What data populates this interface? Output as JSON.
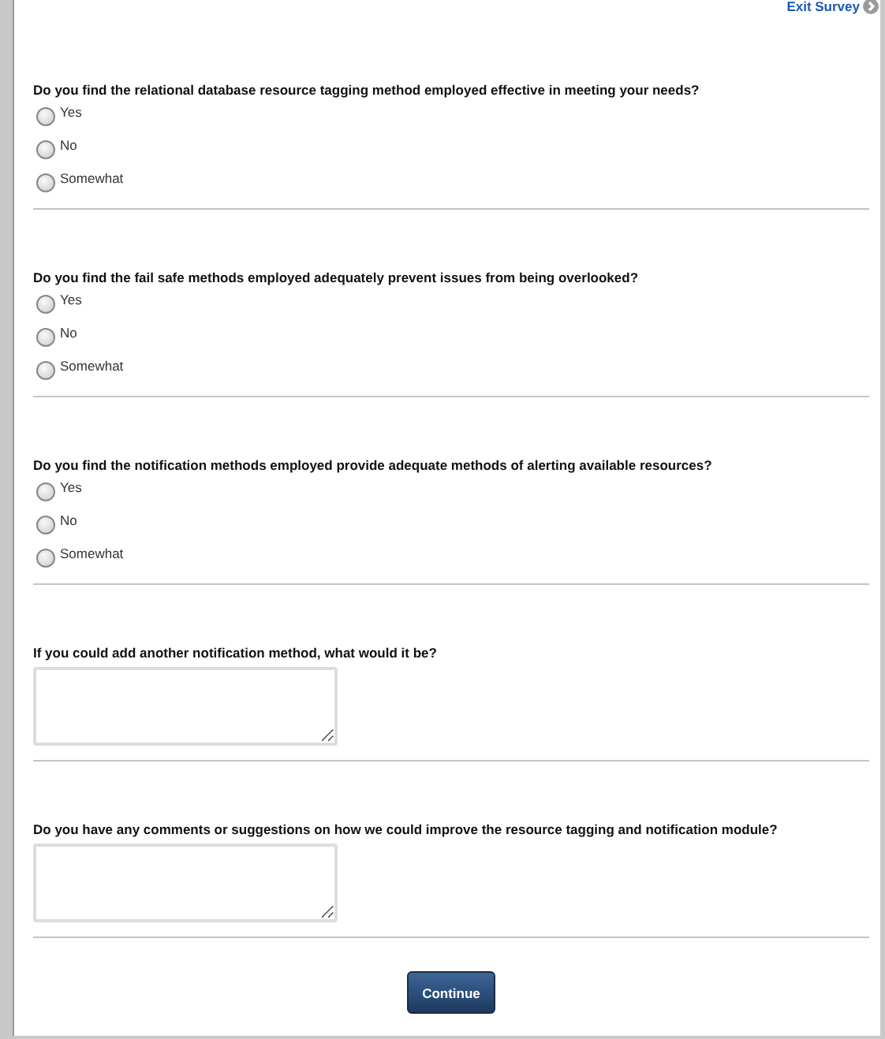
{
  "exit_link": {
    "label": "Exit Survey"
  },
  "questions": [
    {
      "kind": "radio",
      "text": "Do you find the relational database resource tagging method employed effective in meeting your needs?",
      "options": [
        {
          "label": "Yes",
          "selected": false
        },
        {
          "label": "No",
          "selected": false
        },
        {
          "label": "Somewhat",
          "selected": false
        }
      ]
    },
    {
      "kind": "radio",
      "text": "Do you find the fail safe methods employed adequately prevent issues from being overlooked?",
      "options": [
        {
          "label": "Yes",
          "selected": false
        },
        {
          "label": "No",
          "selected": false
        },
        {
          "label": "Somewhat",
          "selected": false
        }
      ]
    },
    {
      "kind": "radio",
      "text": "Do you find the notification methods employed provide adequate methods of alerting available resources?",
      "options": [
        {
          "label": "Yes",
          "selected": false
        },
        {
          "label": "No",
          "selected": false
        },
        {
          "label": "Somewhat",
          "selected": false
        }
      ]
    },
    {
      "kind": "text",
      "text": "If you could add another notification method, what would it be?"
    },
    {
      "kind": "text",
      "text": "Do you have any comments or suggestions on how we could improve the resource tagging and notification module?"
    }
  ],
  "continue_button": {
    "label": "Continue"
  }
}
